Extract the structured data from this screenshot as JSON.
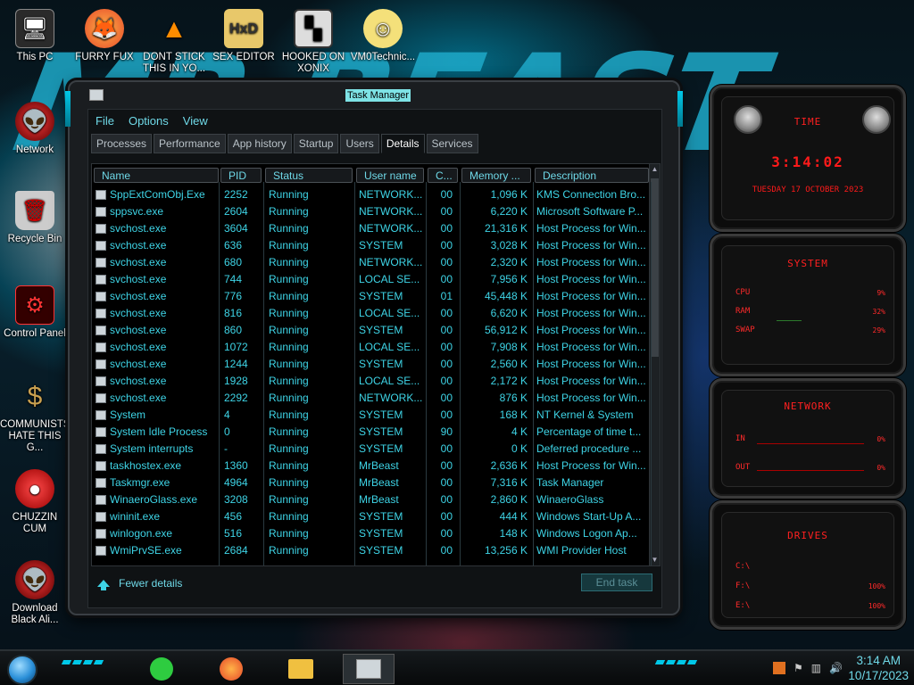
{
  "desktop": {
    "icons": [
      {
        "label": "This PC"
      },
      {
        "label": "FURRY FUX"
      },
      {
        "label": "DONT STICK THIS IN YO..."
      },
      {
        "label": "SEX EDITOR"
      },
      {
        "label": "HOOKED ON XONIX"
      },
      {
        "label": "VM0Technic..."
      },
      {
        "label": "Network"
      },
      {
        "label": "Recycle Bin"
      },
      {
        "label": "Control Panel"
      },
      {
        "label": "COMMUNISTS HATE THIS G..."
      },
      {
        "label": "CHUZZIN CUM"
      },
      {
        "label": "Download Black Ali..."
      }
    ]
  },
  "taskmanager": {
    "title": "Task Manager",
    "menu": [
      "File",
      "Options",
      "View"
    ],
    "tabs": [
      "Processes",
      "Performance",
      "App history",
      "Startup",
      "Users",
      "Details",
      "Services"
    ],
    "active_tab": "Details",
    "columns": [
      "Name",
      "PID",
      "Status",
      "User name",
      "C...",
      "Memory ...",
      "Description"
    ],
    "rows": [
      [
        "SppExtComObj.Exe",
        "2252",
        "Running",
        "NETWORK...",
        "00",
        "1,096 K",
        "KMS Connection Bro..."
      ],
      [
        "sppsvc.exe",
        "2604",
        "Running",
        "NETWORK...",
        "00",
        "6,220 K",
        "Microsoft Software P..."
      ],
      [
        "svchost.exe",
        "3604",
        "Running",
        "NETWORK...",
        "00",
        "21,316 K",
        "Host Process for Win..."
      ],
      [
        "svchost.exe",
        "636",
        "Running",
        "SYSTEM",
        "00",
        "3,028 K",
        "Host Process for Win..."
      ],
      [
        "svchost.exe",
        "680",
        "Running",
        "NETWORK...",
        "00",
        "2,320 K",
        "Host Process for Win..."
      ],
      [
        "svchost.exe",
        "744",
        "Running",
        "LOCAL SE...",
        "00",
        "7,956 K",
        "Host Process for Win..."
      ],
      [
        "svchost.exe",
        "776",
        "Running",
        "SYSTEM",
        "01",
        "45,448 K",
        "Host Process for Win..."
      ],
      [
        "svchost.exe",
        "816",
        "Running",
        "LOCAL SE...",
        "00",
        "6,620 K",
        "Host Process for Win..."
      ],
      [
        "svchost.exe",
        "860",
        "Running",
        "SYSTEM",
        "00",
        "56,912 K",
        "Host Process for Win..."
      ],
      [
        "svchost.exe",
        "1072",
        "Running",
        "LOCAL SE...",
        "00",
        "7,908 K",
        "Host Process for Win..."
      ],
      [
        "svchost.exe",
        "1244",
        "Running",
        "SYSTEM",
        "00",
        "2,560 K",
        "Host Process for Win..."
      ],
      [
        "svchost.exe",
        "1928",
        "Running",
        "LOCAL SE...",
        "00",
        "2,172 K",
        "Host Process for Win..."
      ],
      [
        "svchost.exe",
        "2292",
        "Running",
        "NETWORK...",
        "00",
        "876 K",
        "Host Process for Win..."
      ],
      [
        "System",
        "4",
        "Running",
        "SYSTEM",
        "00",
        "168 K",
        "NT Kernel & System"
      ],
      [
        "System Idle Process",
        "0",
        "Running",
        "SYSTEM",
        "90",
        "4 K",
        "Percentage of time t..."
      ],
      [
        "System interrupts",
        "-",
        "Running",
        "SYSTEM",
        "00",
        "0 K",
        "Deferred procedure ..."
      ],
      [
        "taskhostex.exe",
        "1360",
        "Running",
        "MrBeast",
        "00",
        "2,636 K",
        "Host Process for Win..."
      ],
      [
        "Taskmgr.exe",
        "4964",
        "Running",
        "MrBeast",
        "00",
        "7,316 K",
        "Task Manager"
      ],
      [
        "WinaeroGlass.exe",
        "3208",
        "Running",
        "MrBeast",
        "00",
        "2,860 K",
        "WinaeroGlass"
      ],
      [
        "wininit.exe",
        "456",
        "Running",
        "SYSTEM",
        "00",
        "444 K",
        "Windows Start-Up A..."
      ],
      [
        "winlogon.exe",
        "516",
        "Running",
        "SYSTEM",
        "00",
        "148 K",
        "Windows Logon Ap..."
      ],
      [
        "WmiPrvSE.exe",
        "2684",
        "Running",
        "SYSTEM",
        "00",
        "13,256 K",
        "WMI Provider Host"
      ]
    ],
    "fewer_details": "Fewer details",
    "end_task": "End task"
  },
  "gadgets": {
    "clock": {
      "title": "TIME",
      "time": "3:14:02",
      "date": "TUESDAY 17 OCTOBER 2023"
    },
    "system": {
      "title": "SYSTEM",
      "cpu_label": "CPU",
      "ram_label": "RAM",
      "swap_label": "SWAP",
      "cpu_value": "9%",
      "ram_value": "32%",
      "swap_value": "29%"
    },
    "network": {
      "title": "NETWORK",
      "in_label": "IN",
      "out_label": "OUT",
      "in_value": "0%",
      "out_value": "0%"
    },
    "drives": {
      "title": "DRIVES",
      "items": [
        {
          "label": "C:\\",
          "value": ""
        },
        {
          "label": "F:\\",
          "value": "100%"
        },
        {
          "label": "E:\\",
          "value": "100%"
        }
      ]
    }
  },
  "taskbar": {
    "time": "3:14 AM",
    "date": "10/17/2023"
  },
  "colors": {
    "accent": "#3ed4e6",
    "gadget_red": "#ff1a1a",
    "window_bg": "#1a1d20"
  }
}
